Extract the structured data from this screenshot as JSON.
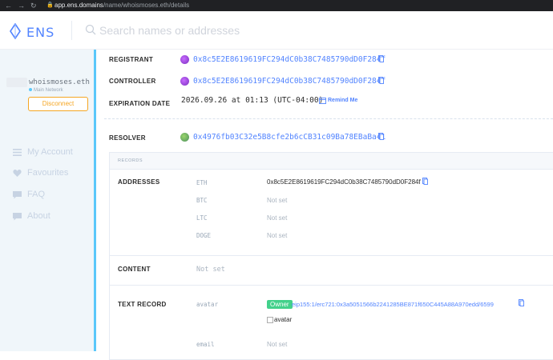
{
  "browser": {
    "url_host": "app.ens.domains",
    "url_path": "/name/whoismoses.eth/details"
  },
  "header": {
    "logo_text": "ENS",
    "search_placeholder": "Search names or addresses"
  },
  "sidebar": {
    "account_name": "whoismoses.eth",
    "network": "Main Network",
    "disconnect_label": "Disconnect",
    "items": [
      {
        "label": "My Account",
        "icon": "user-icon"
      },
      {
        "label": "Favourites",
        "icon": "heart-icon"
      },
      {
        "label": "FAQ",
        "icon": "chat-icon"
      },
      {
        "label": "About",
        "icon": "chat-icon"
      }
    ]
  },
  "details": {
    "registrant_label": "REGISTRANT",
    "registrant_address": "0x8c5E2E8619619FC294dC0b38C7485790dD0F284f",
    "controller_label": "CONTROLLER",
    "controller_address": "0x8c5E2E8619619FC294dC0b38C7485790dD0F284f",
    "expiration_label": "EXPIRATION DATE",
    "expiration_value": "2026.09.26 at 01:13 (UTC-04:00)",
    "remind_label": "Remind Me",
    "resolver_label": "RESOLVER",
    "resolver_address": "0x4976fb03C32e5B8cfe2b6cCB31c09Ba78EBaBa41"
  },
  "records": {
    "title": "RECORDS",
    "addresses_label": "ADDRESSES",
    "addresses": [
      {
        "key": "ETH",
        "value": "0x8c5E2E8619619FC294dC0b38C7485790dD0F284f"
      },
      {
        "key": "BTC",
        "value": "Not set"
      },
      {
        "key": "LTC",
        "value": "Not set"
      },
      {
        "key": "DOGE",
        "value": "Not set"
      }
    ],
    "content_label": "CONTENT",
    "content_value": "Not set",
    "text_record_label": "TEXT RECORD",
    "avatar_key": "avatar",
    "owner_badge": "Owner",
    "avatar_value": "eip155:1/erc721:0x3a5051566b2241285BE871f650C445A88A970edd/6599",
    "avatar_img_alt": "avatar",
    "email_key": "email",
    "email_value": "Not set"
  },
  "colors": {
    "accent": "#5284ff",
    "sidebar_bg": "#f0f6fa",
    "sidebar_edge": "#5ac8fa",
    "disconnect": "#f5a623",
    "owner_badge": "#42d18b"
  }
}
